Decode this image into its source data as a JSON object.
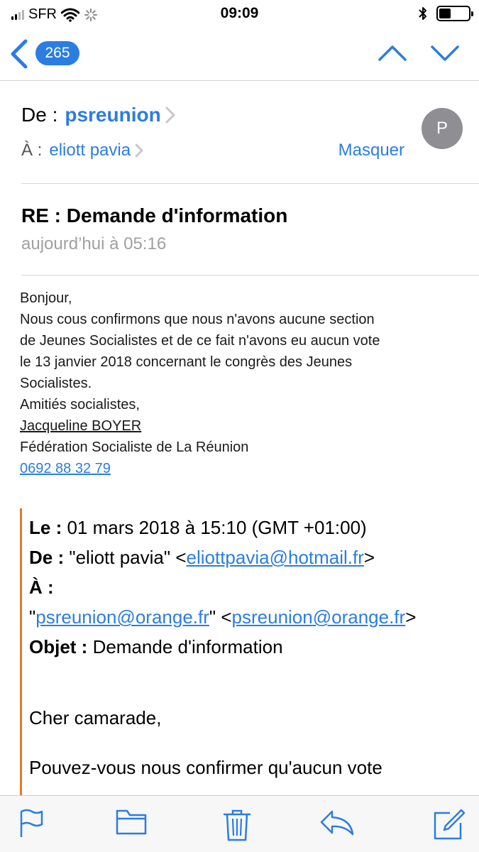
{
  "status_bar": {
    "carrier": "SFR",
    "time": "09:09",
    "signal_bars": 4,
    "signal_bars_active": 2,
    "battery_level": 0.4,
    "icons": [
      "wifi-icon",
      "activity-spinner-icon",
      "bluetooth-icon",
      "battery-icon"
    ]
  },
  "nav": {
    "unread_count": "265",
    "icons": [
      "back-chevron-icon",
      "previous-message-icon",
      "next-message-icon"
    ]
  },
  "header": {
    "from_label": "De :",
    "from_name": "psreunion",
    "to_label": "À :",
    "to_name": "eliott pavia",
    "hide_label": "Masquer",
    "avatar_initial": "P",
    "subject": "RE : Demande d'information",
    "date": "aujourd’hui à 05:16"
  },
  "body": {
    "greeting": "Bonjour,",
    "line1": "Nous cous confirmons que nous n'avons aucune section",
    "line2": "de Jeunes Socialistes et de ce fait n'avons eu aucun vote",
    "line3": "le 13 janvier 2018 concernant le congrès des Jeunes",
    "line4": "Socialistes.",
    "closing": "Amitiés socialistes,",
    "signature_name": "Jacqueline BOYER",
    "signature_org": "Fédération Socialiste de La Réunion",
    "signature_phone": "0692 88 32 79"
  },
  "quoted": {
    "date_label": "Le :",
    "date_value": " 01 mars 2018 à 15:10 (GMT +01:00)",
    "from_label": "De :",
    "from_name": " \"eliott pavia\" <",
    "from_email": "eliottpavia@hotmail.fr",
    "from_close": ">",
    "to_label": "À :",
    "to_open": "\"",
    "to_email_1": "psreunion@orange.fr",
    "to_mid": "\" <",
    "to_email_2": "psreunion@orange.fr",
    "to_close": ">",
    "subject_label": "Objet :",
    "subject_value": " Demande d'information",
    "salutation": "Cher camarade,",
    "text_start": "Pouvez-vous nous confirmer qu'aucun vote"
  },
  "toolbar": {
    "items": [
      "flag-icon",
      "folder-icon",
      "trash-icon",
      "reply-icon",
      "compose-icon"
    ]
  },
  "colors": {
    "accent": "#2b7de1",
    "quote_bar": "#e37a2a",
    "secondary_text": "#a0a0a0"
  }
}
